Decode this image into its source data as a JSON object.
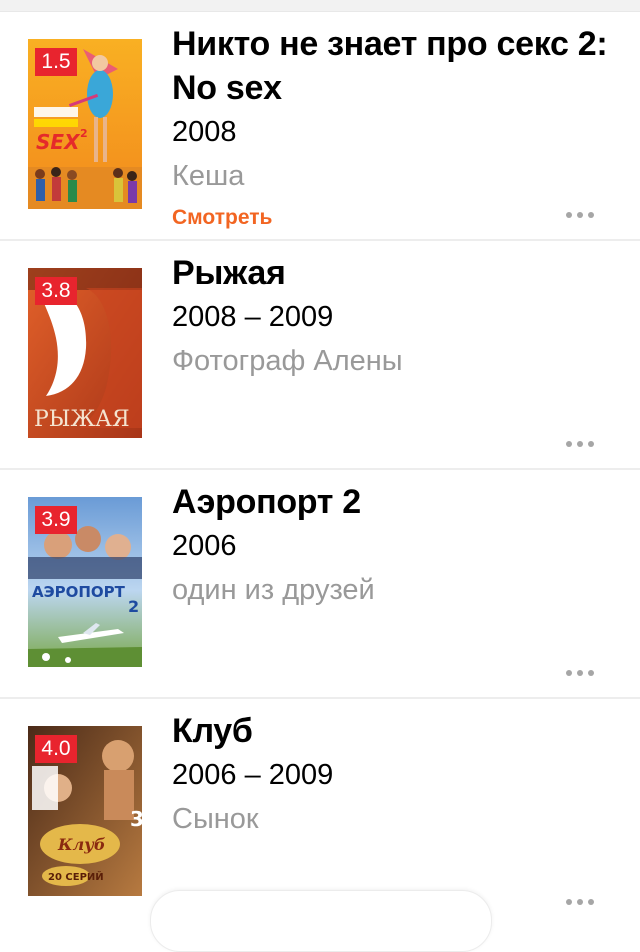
{
  "filmography": [
    {
      "rating": "1.5",
      "title": "Никто не знает про секс 2: No sex",
      "year": "2008",
      "role": "Кеша",
      "watch_label": "Смотреть",
      "poster_colors": [
        "#f7a21b",
        "#f07d1a"
      ]
    },
    {
      "rating": "3.8",
      "title": "Рыжая",
      "year": "2008 – 2009",
      "role": "Фотограф Алены",
      "poster_text": "РЫЖАЯ",
      "poster_colors": [
        "#d9531f",
        "#a8321a"
      ]
    },
    {
      "rating": "3.9",
      "title": "Аэропорт 2",
      "year": "2006",
      "role": "один из друзей",
      "poster_text": "АЭРОПОРТ",
      "poster_colors": [
        "#5a8fd0",
        "#9bc2ea"
      ]
    },
    {
      "rating": "4.0",
      "title": "Клуб",
      "year": "2006 – 2009",
      "role": "Сынок",
      "poster_text": "20 СЕРИЙ",
      "poster_colors": [
        "#6b3a1f",
        "#c98a4b"
      ]
    }
  ],
  "colors": {
    "rating_badge": "#e8242e",
    "watch_link": "#f26522",
    "secondary_text": "#999999"
  },
  "icons": {
    "more": "more-dots-icon"
  }
}
